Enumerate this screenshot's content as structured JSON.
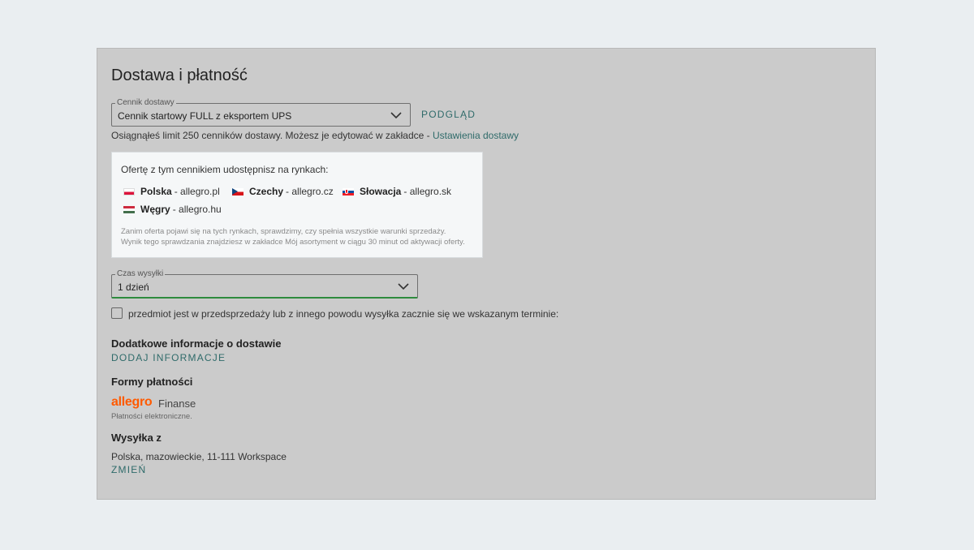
{
  "section": {
    "title": "Dostawa i płatność"
  },
  "cennik": {
    "legend": "Cennik dostawy",
    "value": "Cennik startowy FULL z eksportem UPS",
    "preview_label": "PODGLĄD",
    "limit_text": "Osiągnąłeś limit 250 cenników dostawy. Możesz je edytować w zakładce - ",
    "limit_link": "Ustawienia dostawy"
  },
  "markets": {
    "heading": "Ofertę z tym cennikiem udostępnisz na rynkach:",
    "items": [
      {
        "country": "Polska",
        "domain": "- allegro.pl"
      },
      {
        "country": "Czechy",
        "domain": "- allegro.cz"
      },
      {
        "country": "Słowacja",
        "domain": "- allegro.sk"
      },
      {
        "country": "Węgry",
        "domain": "- allegro.hu"
      }
    ],
    "note_line1": "Zanim oferta pojawi się na tych rynkach, sprawdzimy, czy spełnia wszystkie warunki sprzedaży.",
    "note_line2": "Wynik tego sprawdzania znajdziesz w zakładce Mój asortyment w ciągu 30 minut od aktywacji oferty."
  },
  "czas": {
    "legend": "Czas wysyłki",
    "value": "1 dzień"
  },
  "presale": {
    "label": "przedmiot jest w przedsprzedaży lub z innego powodu wysyłka zacznie się we wskazanym terminie:",
    "checked": false
  },
  "additional": {
    "title": "Dodatkowe informacje o dostawie",
    "action": "DODAJ INFORMACJE"
  },
  "payment": {
    "title": "Formy płatności",
    "logo_text": "allegro",
    "logo_suffix": "Finanse",
    "note": "Płatności elektroniczne."
  },
  "shipping_from": {
    "title": "Wysyłka z",
    "address": "Polska, mazowieckie, 11-111 Workspace",
    "action": "ZMIEŃ"
  },
  "colors": {
    "accent_link": "#2f6b6a",
    "brand_orange": "#ff5a00",
    "active_underline": "#2e8b3e"
  }
}
